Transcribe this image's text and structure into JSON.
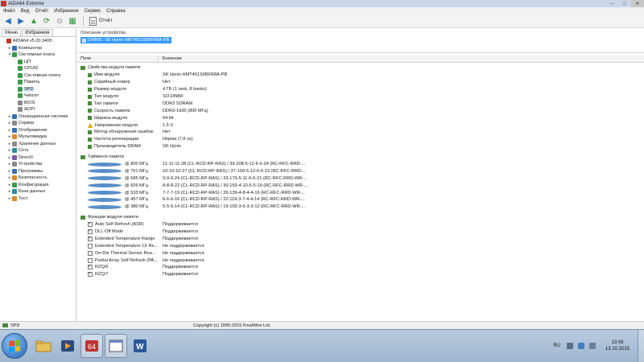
{
  "window": {
    "title": "AIDA64 Extreme"
  },
  "menu": [
    "Файл",
    "Вид",
    "Отчёт",
    "Избранное",
    "Сервис",
    "Справка"
  ],
  "toolbar": {
    "report_label": "Отчёт"
  },
  "left_tabs": [
    "Меню",
    "Избранное"
  ],
  "tree": [
    {
      "label": "AIDA64 v5.20.3400",
      "level": 0,
      "exp": "",
      "icon": "red"
    },
    {
      "label": "Компьютер",
      "level": 1,
      "exp": "▸",
      "icon": "blue"
    },
    {
      "label": "Системная плата",
      "level": 1,
      "exp": "▾",
      "icon": "green"
    },
    {
      "label": "ЦП",
      "level": 2,
      "exp": "",
      "icon": "green"
    },
    {
      "label": "CPUID",
      "level": 2,
      "exp": "",
      "icon": "green"
    },
    {
      "label": "Системная плата",
      "level": 2,
      "exp": "",
      "icon": "green"
    },
    {
      "label": "Память",
      "level": 2,
      "exp": "",
      "icon": "green"
    },
    {
      "label": "SPD",
      "level": 2,
      "exp": "",
      "icon": "green",
      "selected": true
    },
    {
      "label": "Чипсет",
      "level": 2,
      "exp": "",
      "icon": "green"
    },
    {
      "label": "BIOS",
      "level": 2,
      "exp": "",
      "icon": "gray"
    },
    {
      "label": "ACPI",
      "level": 2,
      "exp": "",
      "icon": "gray"
    },
    {
      "label": "Операционная система",
      "level": 1,
      "exp": "▸",
      "icon": "blue"
    },
    {
      "label": "Сервер",
      "level": 1,
      "exp": "▸",
      "icon": "gray"
    },
    {
      "label": "Отображение",
      "level": 1,
      "exp": "▸",
      "icon": "blue"
    },
    {
      "label": "Мультимедиа",
      "level": 1,
      "exp": "▸",
      "icon": "orange"
    },
    {
      "label": "Хранение данных",
      "level": 1,
      "exp": "▸",
      "icon": "gray"
    },
    {
      "label": "Сеть",
      "level": 1,
      "exp": "▸",
      "icon": "teal"
    },
    {
      "label": "DirectX",
      "level": 1,
      "exp": "▸",
      "icon": "purple"
    },
    {
      "label": "Устройства",
      "level": 1,
      "exp": "▸",
      "icon": "gray"
    },
    {
      "label": "Программы",
      "level": 1,
      "exp": "▸",
      "icon": "blue"
    },
    {
      "label": "Безопасность",
      "level": 1,
      "exp": "▸",
      "icon": "orange"
    },
    {
      "label": "Конфигурация",
      "level": 1,
      "exp": "▸",
      "icon": "green"
    },
    {
      "label": "База данных",
      "level": 1,
      "exp": "▸",
      "icon": "teal"
    },
    {
      "label": "Тест",
      "level": 1,
      "exp": "▸",
      "icon": "orange"
    }
  ],
  "device": {
    "header": "Описание устройства",
    "item": "DIMM1: SK Hynix HMT451S6BFR8A-PB"
  },
  "columns": {
    "field": "Поле",
    "value": "Значение"
  },
  "groups": [
    {
      "title": "Свойства модуля памяти",
      "rows": [
        {
          "field": "Имя модуля",
          "value": "SK Hynix HMT451S6BFR8A-PB",
          "icon": "green"
        },
        {
          "field": "Серийный номер",
          "value": "Нет",
          "icon": "green"
        },
        {
          "field": "Размер модуля",
          "value": "4 ГБ (1 rank, 8 banks)",
          "icon": "green"
        },
        {
          "field": "Тип модуля",
          "value": "SO-DIMM",
          "icon": "green"
        },
        {
          "field": "Тип памяти",
          "value": "DDR3 SDRAM",
          "icon": "green"
        },
        {
          "field": "Скорость памяти",
          "value": "DDR3-1600 (800 МГц)",
          "icon": "green"
        },
        {
          "field": "Ширина модуля",
          "value": "64 bit",
          "icon": "green"
        },
        {
          "field": "Напряжение модуля",
          "value": "1.5 V",
          "icon": "warn"
        },
        {
          "field": "Метод обнаружения ошибок",
          "value": "Нет",
          "icon": "green"
        },
        {
          "field": "Частота регенерации",
          "value": "Норма (7.8 us)",
          "icon": "green"
        },
        {
          "field": "Производитель DRAM",
          "value": "SK Hynix",
          "icon": "green"
        }
      ]
    },
    {
      "title": "Тайминги памяти",
      "rows": [
        {
          "field": "@ 800 МГц",
          "value": "11-11-11-28  (CL-RCD-RP-RAS) / 39-208-5-12-6-6-24  (RC-RFC-RRD-...",
          "icon": "clock"
        },
        {
          "field": "@ 761 МГц",
          "value": "10-10-10-27  (CL-RCD-RP-RAS) / 37-199-5-12-6-6-23  (RC-RFC-RRD-...",
          "icon": "clock"
        },
        {
          "field": "@ 685 МГц",
          "value": "9-9-9-24  (CL-RCD-RP-RAS) / 33-179-5-11-6-6-21  (RC-RFC-RRD-WR-...",
          "icon": "clock"
        },
        {
          "field": "@ 609 МГц",
          "value": "8-8-8-22  (CL-RCD-RP-RAS) / 30-159-4-10-5-5-19  (RC-RFC-RRD-WR-...",
          "icon": "clock"
        },
        {
          "field": "@ 533 МГц",
          "value": "7-7-7-19  (CL-RCD-RP-RAS) / 26-139-4-8-4-4-16  (RC-RFC-RRD-WR-...",
          "icon": "clock"
        },
        {
          "field": "@ 457 МГц",
          "value": "6-6-6-16  (CL-RCD-RP-RAS) / 22-119-3-7-4-4-14  (RC-RFC-RRD-WR-...",
          "icon": "clock"
        },
        {
          "field": "@ 380 МГц",
          "value": "5-5-5-14  (CL-RCD-RP-RAS) / 19-100-3-6-3-3-12  (RC-RFC-RRD-WR-...",
          "icon": "clock"
        }
      ]
    },
    {
      "title": "Функции модуля памяти",
      "rows": [
        {
          "field": "Auto Self Refresh (ASR)",
          "value": "Поддерживается",
          "check": true
        },
        {
          "field": "DLL-Off Mode",
          "value": "Поддерживается",
          "check": true
        },
        {
          "field": "Extended Temperature Range",
          "value": "Поддерживается",
          "check": true
        },
        {
          "field": "Extended Temperature 1X Re...",
          "value": "Не поддерживается",
          "check": false
        },
        {
          "field": "On-Die Thermal Sensor Rea...",
          "value": "Не поддерживается",
          "check": false
        },
        {
          "field": "Partial Array Self Refresh (PA...",
          "value": "Не поддерживается",
          "check": false
        },
        {
          "field": "RZQ/6",
          "value": "Поддерживается",
          "check": true
        },
        {
          "field": "RZQ/7",
          "value": "Поддерживается",
          "check": true
        }
      ]
    }
  ],
  "status": {
    "left": "SPD",
    "center": "Copyright (c) 1995-2015 FinalWire Ltd."
  },
  "taskbar": {
    "lang": "RU",
    "time": "13:43",
    "date": "13.10.2015"
  }
}
